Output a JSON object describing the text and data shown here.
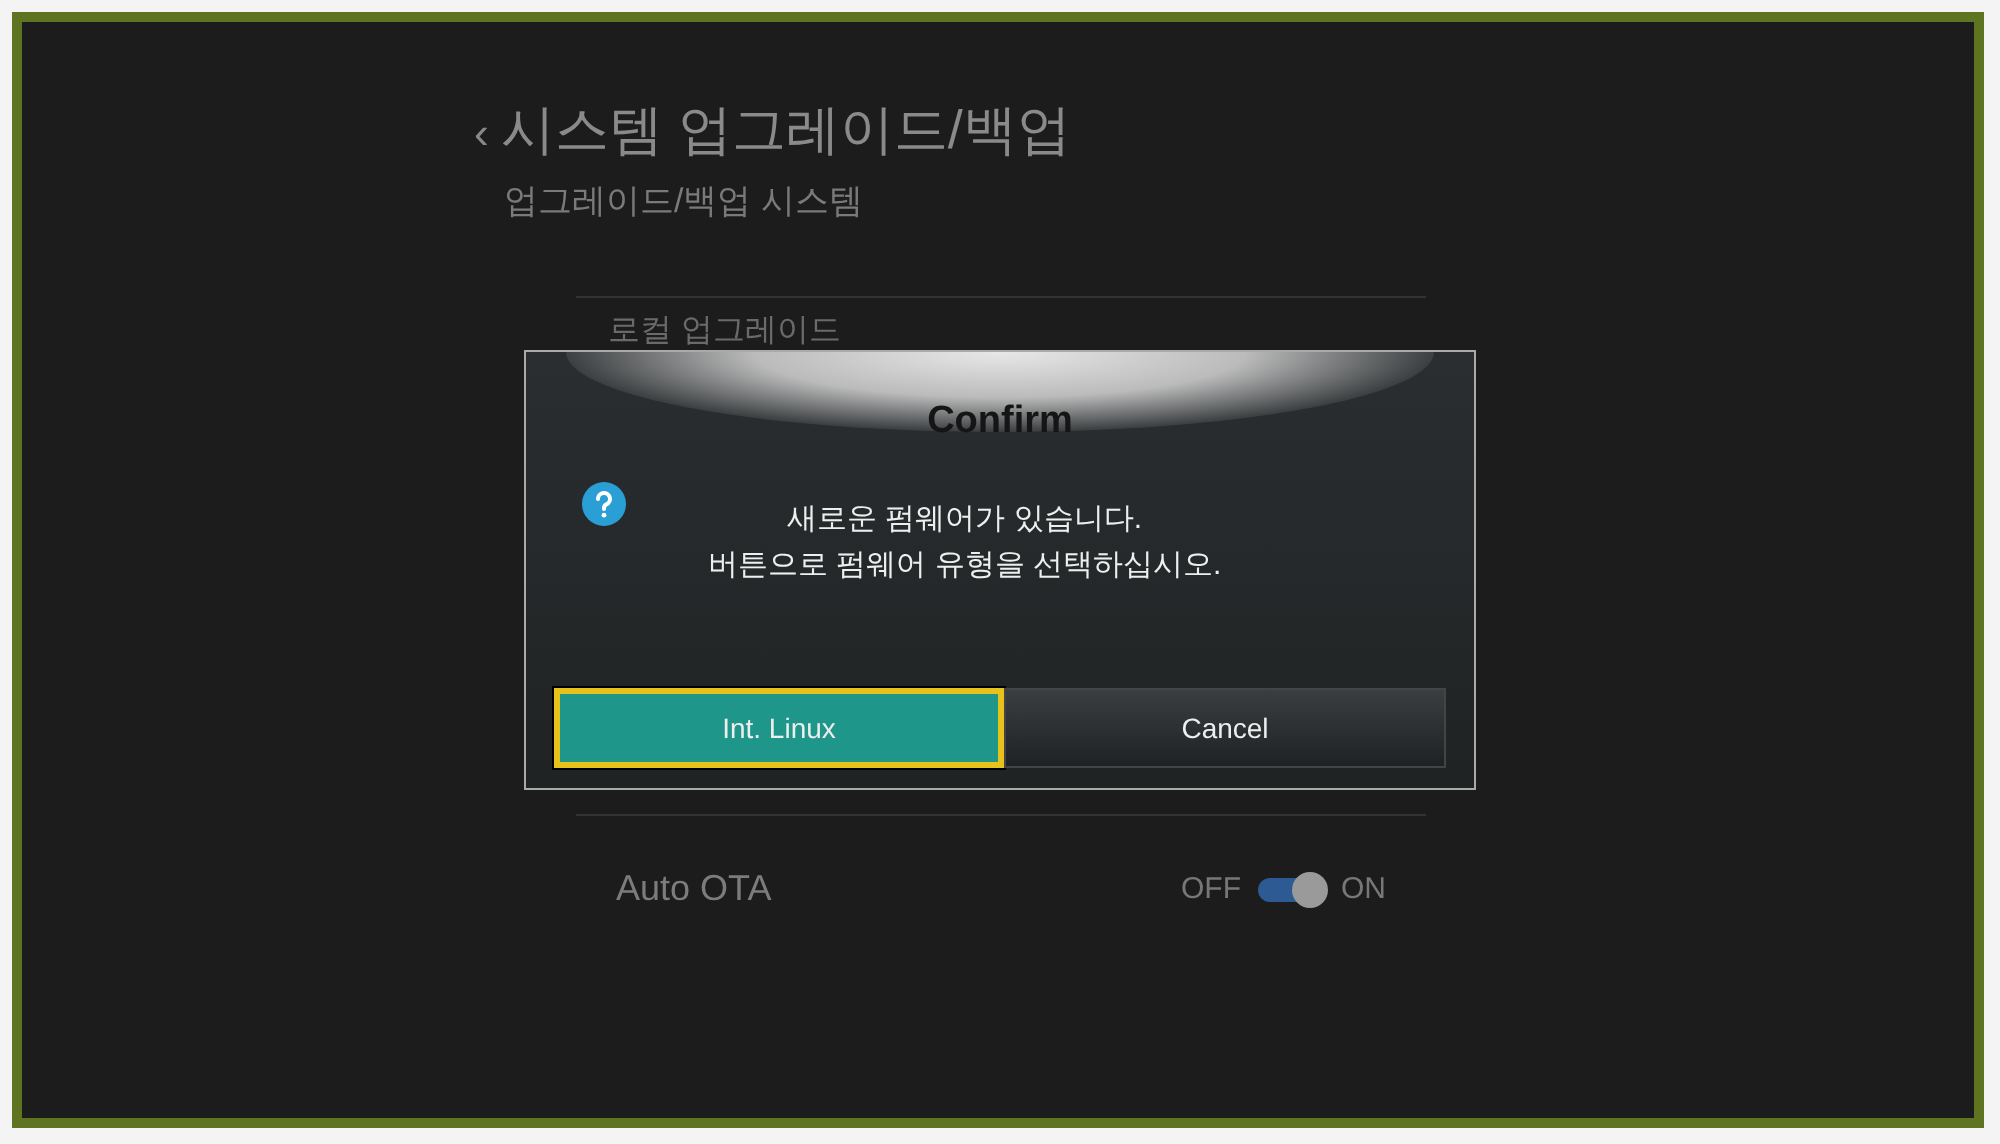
{
  "header": {
    "back_icon": "‹",
    "title": "시스템 업그레이드/백업",
    "subtitle": "업그레이드/백업 시스템"
  },
  "menu": [
    {
      "label": "로컬 업그레이드"
    }
  ],
  "settings": [
    {
      "label": "Auto OTA",
      "kind": "toggle",
      "off_label": "OFF",
      "on_label": "ON",
      "on": true
    }
  ],
  "dialog": {
    "title": "Confirm",
    "message_lines": [
      "새로운 펌웨어가 있습니다.",
      "버튼으로 펌웨어 유형을 선택하십시오."
    ],
    "buttons": [
      {
        "label": "Int. Linux",
        "selected": true
      },
      {
        "label": "Cancel",
        "selected": false
      }
    ]
  }
}
